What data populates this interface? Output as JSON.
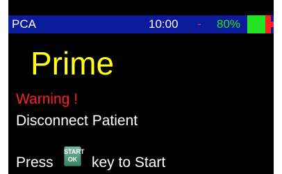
{
  "status_bar": {
    "mode": "PCA",
    "time": "10:00",
    "separator": "-",
    "battery": "80%",
    "colors": {
      "bar": "#0a1a9a",
      "battery_green": "#22e322",
      "battery_red": "#ff2020"
    }
  },
  "screen": {
    "title": "Prime",
    "warning": "Warning !",
    "instruction": "Disconnect Patient",
    "press_prefix": "Press",
    "key_icon": {
      "name": "start-ok-key-icon",
      "top_label": "START",
      "bottom_label": "OK"
    },
    "press_suffix": "key to Start"
  },
  "colors": {
    "background": "#000000",
    "title": "#ffff1a",
    "warning": "#ff2020",
    "text": "#ffffff"
  }
}
